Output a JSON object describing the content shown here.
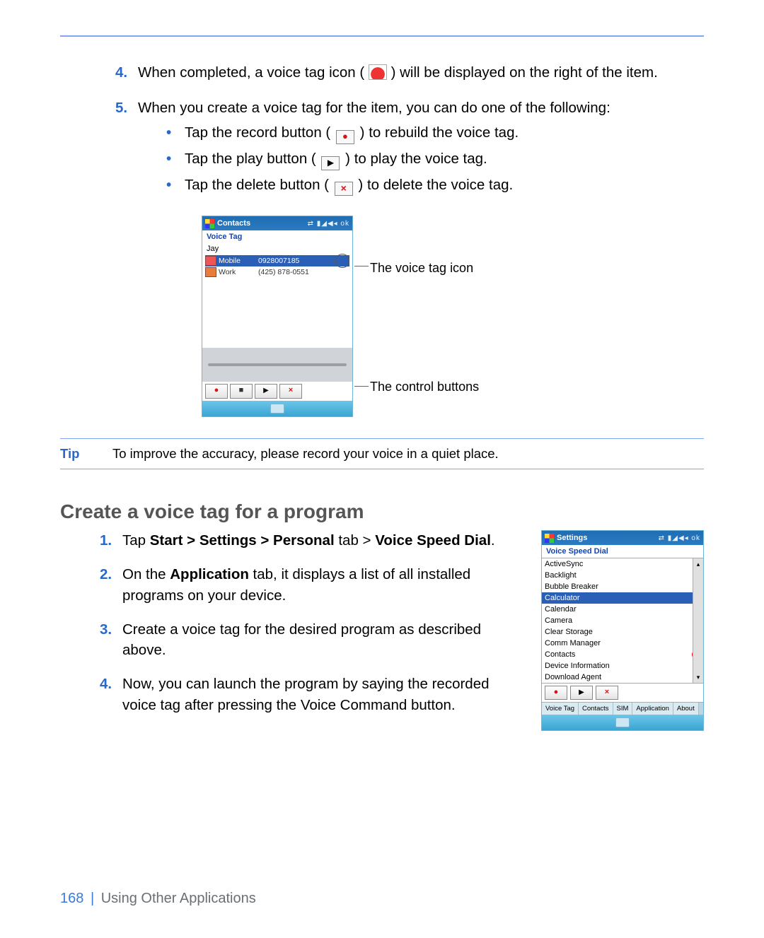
{
  "list1": {
    "item4_pre": "When completed, a voice tag icon (",
    "item4_post": ") will be displayed on the right of the item.",
    "item5": "When you create a voice tag for the item, you can do one of the following:",
    "bullets": {
      "b1_pre": "Tap the record button (",
      "b1_post": ") to rebuild the voice tag.",
      "b2_pre": "Tap the play button (",
      "b2_post": ") to play the voice tag.",
      "b3_pre": "Tap the delete button (",
      "b3_post": ") to delete the voice tag."
    }
  },
  "fig1": {
    "title": "Contacts",
    "status_icons": "⇄ ▮◢◀◂ ok",
    "subtitle": "Voice Tag",
    "owner": "Jay",
    "row1": {
      "label": "Mobile",
      "number": "0928007185"
    },
    "row2": {
      "label": "Work",
      "number": "(425) 878-0551"
    },
    "label_icon": "The voice tag icon",
    "label_controls": "The control buttons"
  },
  "tip": {
    "label": "Tip",
    "text": "To improve the accuracy, please record your voice in a quiet place."
  },
  "heading2": "Create a voice tag for a program",
  "list2": {
    "item1_a": "Tap ",
    "item1_b": "Start > Settings > Personal",
    "item1_c": " tab > ",
    "item1_d": "Voice Speed Dial",
    "item1_e": ".",
    "item2_a": "On the ",
    "item2_b": "Application",
    "item2_c": " tab, it displays a list of all installed programs on your device.",
    "item3": "Create a voice tag for the desired program as described above.",
    "item4": "Now, you can launch the program by saying the recorded voice tag after pressing the Voice Command button."
  },
  "fig2": {
    "title": "Settings",
    "status_icons": "⇄ ▮◢◀◂ ok",
    "subtitle": "Voice Speed Dial",
    "apps": [
      "ActiveSync",
      "Backlight",
      "Bubble Breaker",
      "Calculator",
      "Calendar",
      "Camera",
      "Clear Storage",
      "Comm Manager",
      "Contacts",
      "Device Information",
      "Download Agent"
    ],
    "selected_index": 3,
    "tagged_index": 8,
    "tabs": [
      "Voice Tag",
      "Contacts",
      "SIM",
      "Application",
      "About"
    ]
  },
  "footer": {
    "page": "168",
    "chapter": "Using Other Applications"
  }
}
